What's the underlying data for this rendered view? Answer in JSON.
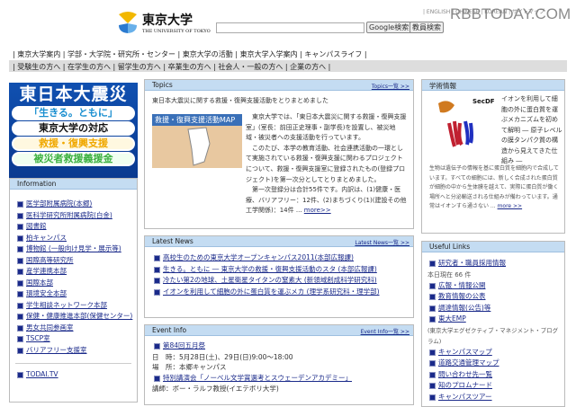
{
  "header": {
    "top_links": "| ENGLISH | CHINESE | KOREAN | サイトマップ",
    "watermark": "RBBTODAY.COM",
    "logo_jp": "東京大学",
    "logo_en": "THE UNIVERSITY OF TOKYO",
    "search_placeholder": "",
    "google_button": "Google検索",
    "staff_button": "教員検索"
  },
  "nav_main": "| 東京大学案内 | 学部・大学院・研究所・センター | 東京大学の活動 | 東京大学入学案内 | キャンパスライフ |",
  "nav_audience": "| 受験生の方へ | 在学生の方へ | 留学生の方へ | 卒業生の方へ | 社会人・一般の方へ | 企業の方へ |",
  "banner": {
    "title": "東日本大震災",
    "items": [
      "「生きる。ともに」",
      "東京大学の対応",
      "救援・復興支援",
      "被災者救援義援金"
    ],
    "colors": [
      "#1a8fd0",
      "#111111",
      "#f0a800",
      "#3cb040"
    ]
  },
  "information": {
    "title": "Information",
    "items": [
      "医学部附属病院(本郷)",
      "医科学研究所附属病院(白金)",
      "図書館",
      "柏キャンパス",
      "博物館 (一般向け見学・展示等)",
      "国際高等研究所",
      "産学連携本部",
      "国際本部",
      "環境安全本部",
      "学生相談ネットワーク本部",
      "保健・健康推進本部(保健センター)",
      "男女共同参画室",
      "TSCP室",
      "バリアフリー支援室"
    ],
    "extra": [
      "TODAI.TV"
    ]
  },
  "topics": {
    "title": "Topics",
    "more": "Topics一覧 >>",
    "headline": "東日本大震災に関する救援・復興支援活動をとりまとめました",
    "image_caption": "救援・復興支援活動MAP",
    "body": "　東京大学では、「東日本大震災に関する救援・復興支援室」(室長：前田正史理事・副学長)を設置し、被災地域・被災者への支援活動を行っています。\n　このたび、本学の教育活動、社会連携活動の一環として実施されている救援・復興支援に関わるプロジェクトについて、救援・復興支援室に登録されたもの(登録プロジェクト)を第一次分としてとりまとめました。\n　第一次登録分は合計55件です。内訳は、(1)健康・医療、バリアフリー：12件、(2)まちづくり(1)(建設その他工学関係)：14件 ...",
    "more_link": "more>>"
  },
  "latest_news": {
    "title": "Latest News",
    "more": "Latest News一覧 >>",
    "items": [
      "高校生のための東京大学オープンキャンパス2011(本部広報課)",
      "生きる。ともに ― 東京大学の救援・復興支援活動のスタ (本部広報課)",
      "冷たい第2の地球、土星衛星タイタンの窒素大 (新領域創成科学研究科)",
      "イオンを利用して細胞の外に蛋白質を運ぶメカ (理学系研究科・理学部)"
    ]
  },
  "event_info": {
    "title": "Event Info",
    "more": "Event Info一覧 >>",
    "events": [
      {
        "title": "第84回五月祭",
        "lines": [
          "日　時：5月28日(土)、29日(日)9:00～18:00",
          "場　所：本郷キャンパス"
        ]
      },
      {
        "title": "特別講演会「ノーベル文学賞選考とスウェーデンアカデミー」",
        "lines": [
          "講師：ボー・ラルフ教授(イエテボリ大学)"
        ]
      }
    ]
  },
  "research": {
    "title": "学術情報",
    "figure_label": "SecDF",
    "summary": "イオンを利用して細胞の外に蛋白質を運ぶメカニズムを初めて解明 ― 原子レベルの膜タンパク質の構造から見えてきた仕組み ―",
    "body": "生物は遺伝子の情報を基に蛋白質を細胞内で合成しています。すべての細胞には、新しく合成された蛋白質が細胞の中から生体膜を越えて、実際に蛋白質が働く場所へと分泌輸送される仕組みが備わっています。通常はイオンすら通さない ...",
    "more": "more >>"
  },
  "useful_links": {
    "title": "Useful Links",
    "items": [
      {
        "label": "研究者・職員採用情報",
        "note": "本日現在 66 件"
      },
      {
        "label": "広報・情報公開"
      },
      {
        "label": "教育情報の公表"
      },
      {
        "label": "調達情報(公告)等"
      },
      {
        "label": "東大EMP",
        "note": "(東京大学エグゼクティブ・マネジメント・プログラム)"
      },
      {
        "label": "キャンパスマップ"
      },
      {
        "label": "道路交通管理マップ"
      },
      {
        "label": "問い合わせ先一覧"
      },
      {
        "label": "知のプロムナード"
      },
      {
        "label": "キャンパスツアー"
      }
    ]
  }
}
